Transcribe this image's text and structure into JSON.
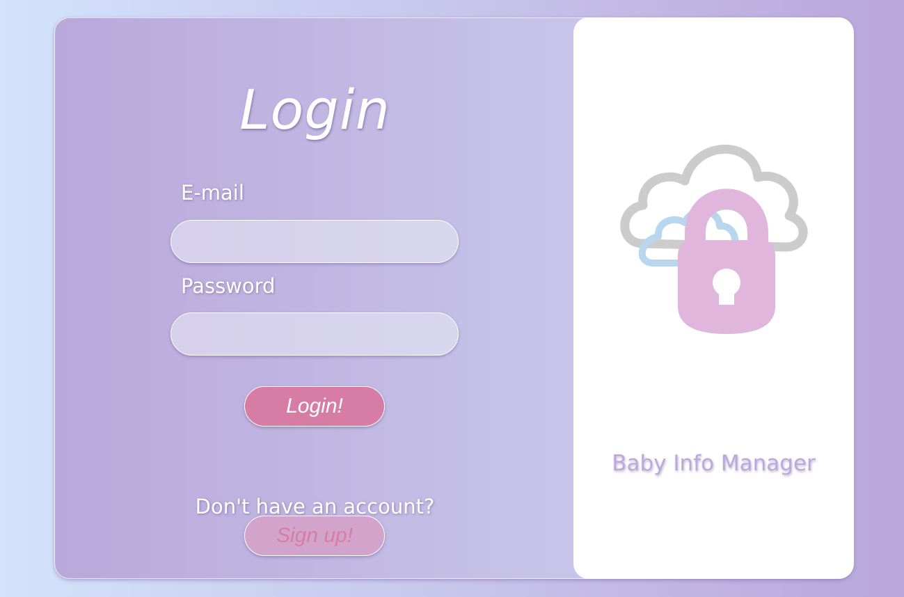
{
  "login_form": {
    "title": "Login",
    "email_label": "E-mail",
    "email_value": "",
    "password_label": "Password",
    "password_value": "",
    "login_button": "Login!",
    "signup_prompt": "Don't have an account?",
    "signup_button": "Sign up!"
  },
  "brand_panel": {
    "logo_icon": "cloud-lock-icon",
    "app_name": "Baby Info Manager"
  },
  "colors": {
    "accent_pink": "#d77ca4",
    "lavender": "#bca9db",
    "lock_pink": "#e0b6dc",
    "cloud_gray": "#cccccc",
    "cloud_blue": "#b8d6ee"
  }
}
